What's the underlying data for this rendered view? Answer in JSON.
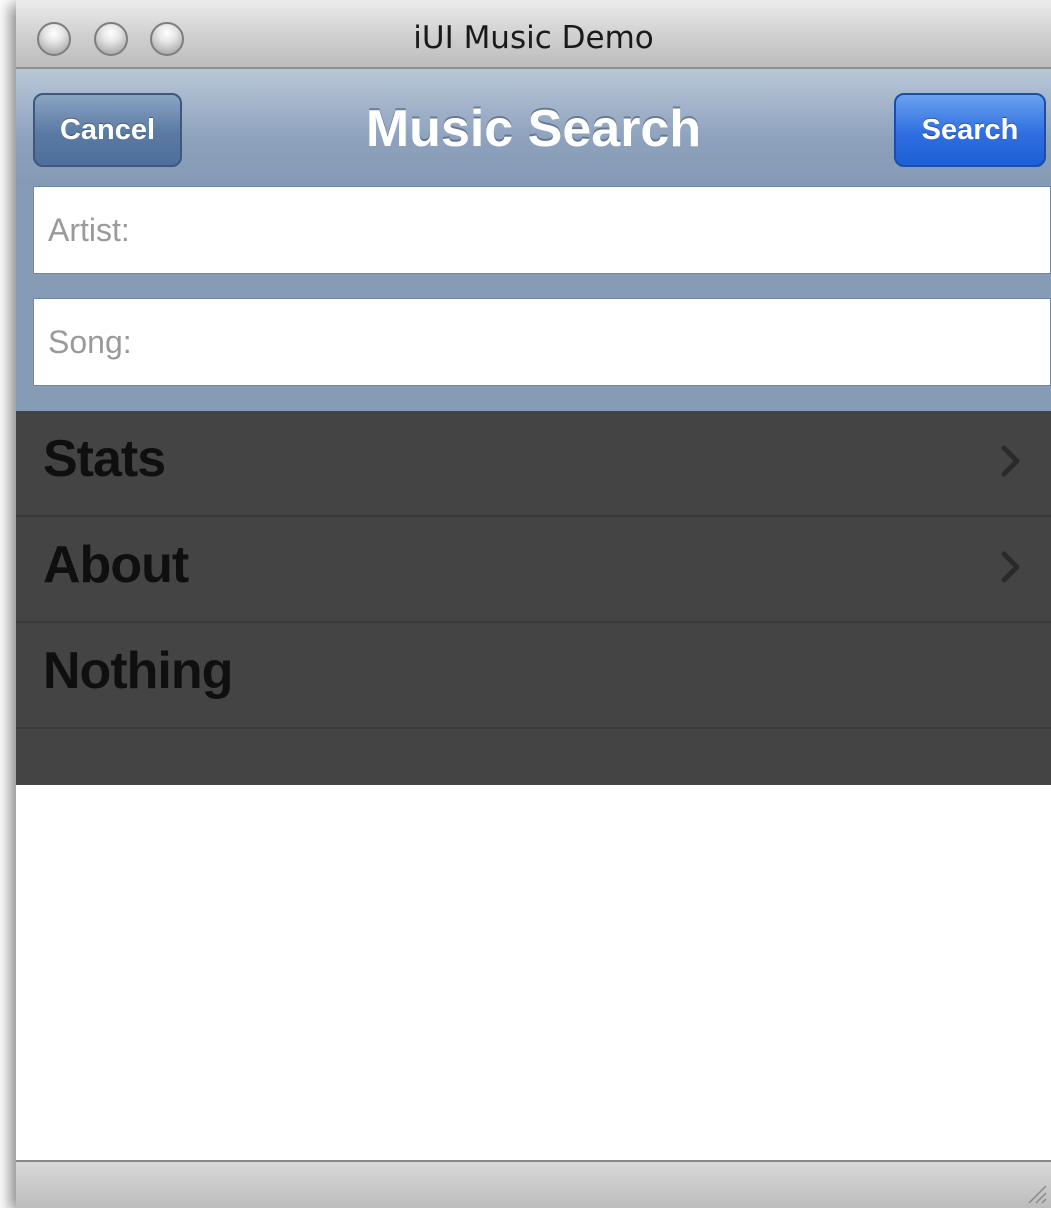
{
  "window": {
    "title": "iUI Music Demo"
  },
  "navbar": {
    "title": "Music Search",
    "cancel_label": "Cancel",
    "search_label": "Search"
  },
  "form": {
    "artist": {
      "value": "",
      "placeholder": "Artist:"
    },
    "song": {
      "value": "",
      "placeholder": "Song:"
    }
  },
  "list": {
    "items": [
      {
        "label": "Stats",
        "icon": "chevron-right-icon"
      },
      {
        "label": "About",
        "icon": "chevron-right-icon"
      },
      {
        "label": "Nothing"
      }
    ]
  },
  "colors": {
    "navbar": "#8ea2bd",
    "search_button": "#2f6fe0",
    "cancel_button": "#5a7aa3",
    "list_background": "#444444"
  }
}
